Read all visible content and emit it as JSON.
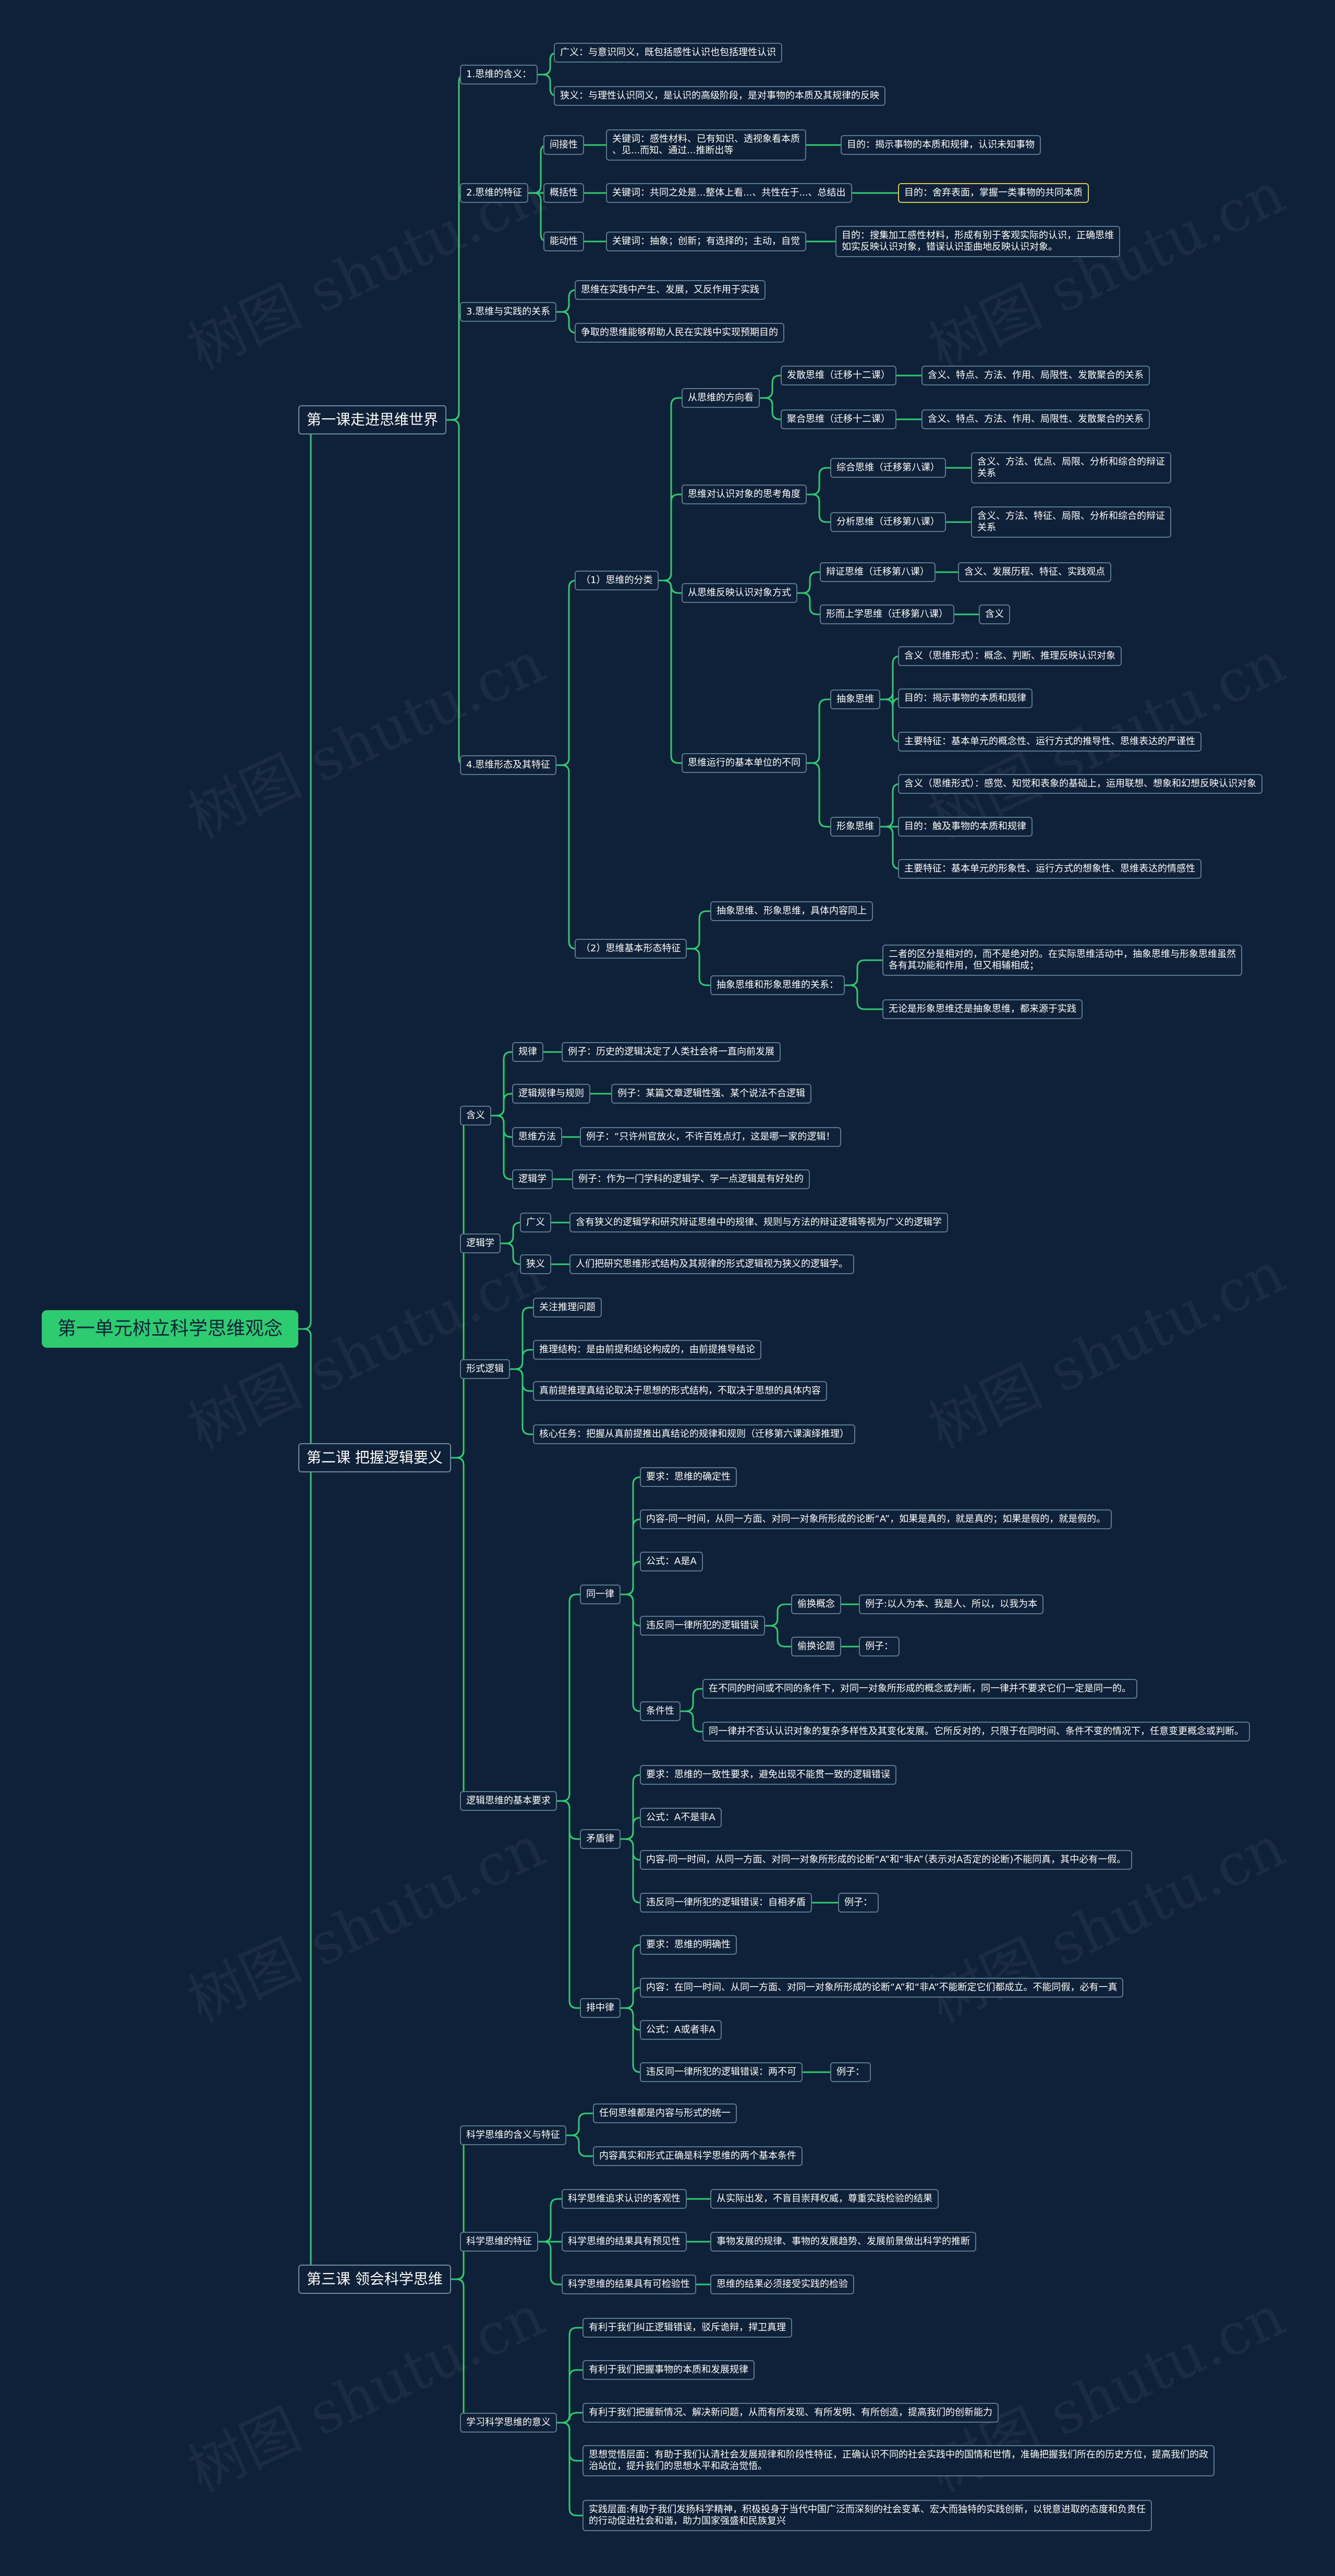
{
  "colors": {
    "background": "#0f2138",
    "root": "#2ecc71",
    "link": "#2ecc71",
    "border": "#5a7a8a",
    "highlight": "#d9c84a"
  },
  "watermark": "树图 shutu.cn",
  "tree": {
    "id": "root",
    "label": "第一单元树立科学思维观念",
    "children": [
      {
        "id": "c1",
        "label": "第一课走进思维世界",
        "children": [
          {
            "id": "c1a",
            "label": "1.思维的含义：",
            "children": [
              {
                "id": "c1a1",
                "label": "广义：与意识同义，既包括感性认识也包括理性认识"
              },
              {
                "id": "c1a2",
                "label": "狭义：与理性认识同义，是认识的高级阶段，是对事物的本质及其规律的反映"
              }
            ]
          },
          {
            "id": "c1b",
            "label": "2.思维的特征",
            "children": [
              {
                "id": "c1b1",
                "label": "间接性",
                "children": [
                  {
                    "id": "c1b1a",
                    "label": "关键词：感性材料、已有知识、透视象看本质\n、见...而知、通过...推断出等",
                    "children": [
                      {
                        "id": "c1b1a1",
                        "label": "目的：揭示事物的本质和规律，认识未知事物"
                      }
                    ]
                  }
                ]
              },
              {
                "id": "c1b2",
                "label": "概括性",
                "children": [
                  {
                    "id": "c1b2a",
                    "label": "关键词：共同之处是...整体上看...、共性在于...、总结出",
                    "children": [
                      {
                        "id": "c1b2a1",
                        "label": "目的：舍弃表面，掌握一类事物的共同本质",
                        "hl": true
                      }
                    ]
                  }
                ]
              },
              {
                "id": "c1b3",
                "label": "能动性",
                "children": [
                  {
                    "id": "c1b3a",
                    "label": "关键词：抽象；创新；有选择的；主动，自觉",
                    "children": [
                      {
                        "id": "c1b3a1",
                        "label": "目的：搜集加工感性材料，形成有别于客观实际的认识，正确思维\n如实反映认识对象，错误认识歪曲地反映认识对象。"
                      }
                    ]
                  }
                ]
              }
            ]
          },
          {
            "id": "c1c",
            "label": "3.思维与实践的关系",
            "children": [
              {
                "id": "c1c1",
                "label": "思维在实践中产生、发展，又反作用于实践"
              },
              {
                "id": "c1c2",
                "label": "争取的思维能够帮助人民在实践中实现预期目的"
              }
            ]
          },
          {
            "id": "c1d",
            "label": "4.思维形态及其特征",
            "children": [
              {
                "id": "c1d1",
                "label": "（1）思维的分类",
                "children": [
                  {
                    "id": "c1d1a",
                    "label": "从思维的方向看",
                    "children": [
                      {
                        "id": "c1d1a1",
                        "label": "发散思维（迁移十二课）",
                        "children": [
                          {
                            "id": "c1d1a1x",
                            "label": "含义、特点、方法、作用、局限性、发散聚合的关系"
                          }
                        ]
                      },
                      {
                        "id": "c1d1a2",
                        "label": "聚合思维（迁移十二课）",
                        "children": [
                          {
                            "id": "c1d1a2x",
                            "label": "含义、特点、方法、作用、局限性、发散聚合的关系"
                          }
                        ]
                      }
                    ]
                  },
                  {
                    "id": "c1d1b",
                    "label": "思维对认识对象的思考角度",
                    "children": [
                      {
                        "id": "c1d1b1",
                        "label": "综合思维（迁移第八课）",
                        "children": [
                          {
                            "id": "c1d1b1x",
                            "label": "含义、方法、优点、局限、分析和综合的辩证\n关系"
                          }
                        ]
                      },
                      {
                        "id": "c1d1b2",
                        "label": "分析思维（迁移第八课）",
                        "children": [
                          {
                            "id": "c1d1b2x",
                            "label": "含义、方法、特征、局限、分析和综合的辩证\n关系"
                          }
                        ]
                      }
                    ]
                  },
                  {
                    "id": "c1d1c",
                    "label": "从思维反映认识对象方式",
                    "children": [
                      {
                        "id": "c1d1c1",
                        "label": "辩证思维（迁移第八课）",
                        "children": [
                          {
                            "id": "c1d1c1x",
                            "label": "含义、发展历程、特征、实践观点"
                          }
                        ]
                      },
                      {
                        "id": "c1d1c2",
                        "label": "形而上学思维（迁移第八课）",
                        "children": [
                          {
                            "id": "c1d1c2x",
                            "label": "含义"
                          }
                        ]
                      }
                    ]
                  },
                  {
                    "id": "c1d1d",
                    "label": "思维运行的基本单位的不同",
                    "children": [
                      {
                        "id": "c1d1d1",
                        "label": "抽象思维",
                        "children": [
                          {
                            "id": "c1d1d1a",
                            "label": "含义（思维形式）：概念、判断、推理反映认识对象"
                          },
                          {
                            "id": "c1d1d1b",
                            "label": "目的：揭示事物的本质和规律"
                          },
                          {
                            "id": "c1d1d1c",
                            "label": "主要特征：基本单元的概念性、运行方式的推导性、思维表达的严谨性"
                          }
                        ]
                      },
                      {
                        "id": "c1d1d2",
                        "label": "形象思维",
                        "children": [
                          {
                            "id": "c1d1d2a",
                            "label": "含义（思维形式）：感觉、知觉和表象的基础上，运用联想、想象和幻想反映认识对象"
                          },
                          {
                            "id": "c1d1d2b",
                            "label": "目的：触及事物的本质和规律"
                          },
                          {
                            "id": "c1d1d2c",
                            "label": "主要特征：基本单元的形象性、运行方式的想象性、思维表达的情感性"
                          }
                        ]
                      }
                    ]
                  }
                ]
              },
              {
                "id": "c1d2",
                "label": "（2）思维基本形态特征",
                "children": [
                  {
                    "id": "c1d2a",
                    "label": "抽象思维、形象思维，具体内容同上"
                  },
                  {
                    "id": "c1d2b",
                    "label": "抽象思维和形象思维的关系：",
                    "children": [
                      {
                        "id": "c1d2b1",
                        "label": "二者的区分是相对的，而不是绝对的。在实际思维活动中，抽象思维与形象思维虽然\n各有其功能和作用，但又相辅相成；"
                      },
                      {
                        "id": "c1d2b2",
                        "label": "无论是形象思维还是抽象思维，都来源于实践"
                      }
                    ]
                  }
                ]
              }
            ]
          }
        ]
      },
      {
        "id": "c2",
        "label": "第二课 把握逻辑要义",
        "children": [
          {
            "id": "c2a",
            "label": "含义",
            "children": [
              {
                "id": "c2a1",
                "label": "规律",
                "children": [
                  {
                    "id": "c2a1x",
                    "label": "例子：历史的逻辑决定了人类社会将一直向前发展"
                  }
                ]
              },
              {
                "id": "c2a2",
                "label": "逻辑规律与规则",
                "children": [
                  {
                    "id": "c2a2x",
                    "label": "例子：某篇文章逻辑性强、某个说法不合逻辑"
                  }
                ]
              },
              {
                "id": "c2a3",
                "label": "思维方法",
                "children": [
                  {
                    "id": "c2a3x",
                    "label": "例子：“只许州官放火，不许百姓点灯，这是哪一家的逻辑！"
                  }
                ]
              },
              {
                "id": "c2a4",
                "label": "逻辑学",
                "children": [
                  {
                    "id": "c2a4x",
                    "label": "例子：作为一门学科的逻辑学、学一点逻辑是有好处的"
                  }
                ]
              }
            ]
          },
          {
            "id": "c2b",
            "label": "逻辑学",
            "children": [
              {
                "id": "c2b1",
                "label": "广义",
                "children": [
                  {
                    "id": "c2b1x",
                    "label": "含有狭义的逻辑学和研究辩证思维中的规律、规则与方法的辩证逻辑等视为广义的逻辑学"
                  }
                ]
              },
              {
                "id": "c2b2",
                "label": "狭义",
                "children": [
                  {
                    "id": "c2b2x",
                    "label": "人们把研究思维形式结构及其规律的形式逻辑视为狭义的逻辑学。"
                  }
                ]
              }
            ]
          },
          {
            "id": "c2c",
            "label": "形式逻辑",
            "children": [
              {
                "id": "c2c1",
                "label": "关注推理问题"
              },
              {
                "id": "c2c2",
                "label": "推理结构：是由前提和结论构成的，由前提推导结论"
              },
              {
                "id": "c2c3",
                "label": "真前提推理真结论取决于思想的形式结构，不取决于思想的具体内容"
              },
              {
                "id": "c2c4",
                "label": "核心任务：把握从真前提推出真结论的规律和规则（迁移第六课演绎推理）"
              }
            ]
          },
          {
            "id": "c2d",
            "label": "逻辑思维的基本要求",
            "children": [
              {
                "id": "c2d1",
                "label": "同一律",
                "children": [
                  {
                    "id": "c2d1a",
                    "label": "要求：思维的确定性"
                  },
                  {
                    "id": "c2d1b",
                    "label": "内容-同一时间，从同一方面、对同一对象所形成的论断“A”，如果是真的，就是真的；如果是假的，就是假的。"
                  },
                  {
                    "id": "c2d1c",
                    "label": "公式：A是A"
                  },
                  {
                    "id": "c2d1d",
                    "label": "违反同一律所犯的逻辑错误",
                    "children": [
                      {
                        "id": "c2d1d1",
                        "label": "偷换概念",
                        "children": [
                          {
                            "id": "c2d1d1x",
                            "label": "例子:以人为本、我是人、所以，以我为本"
                          }
                        ]
                      },
                      {
                        "id": "c2d1d2",
                        "label": "偷换论题",
                        "children": [
                          {
                            "id": "c2d1d2x",
                            "label": "例子："
                          }
                        ]
                      }
                    ]
                  },
                  {
                    "id": "c2d1e",
                    "label": "条件性",
                    "children": [
                      {
                        "id": "c2d1e1",
                        "label": "在不同的时间或不同的条件下，对同一对象所形成的概念或判断，同一律并不要求它们一定是同一的。"
                      },
                      {
                        "id": "c2d1e2",
                        "label": "同一律并不否认认识对象的复杂多样性及其变化发展。它所反对的，只限于在同时间、条件不变的情况下，任意变更概念或判断。"
                      }
                    ]
                  }
                ]
              },
              {
                "id": "c2d2",
                "label": "矛盾律",
                "children": [
                  {
                    "id": "c2d2a",
                    "label": "要求：思维的一致性要求，避免出现不能贯一致的逻辑错误"
                  },
                  {
                    "id": "c2d2b",
                    "label": "公式：A不是非A"
                  },
                  {
                    "id": "c2d2c",
                    "label": "内容-同一时间，从同一方面、对同一对象所形成的论断“A”和“非A”（表示对A否定的论断)不能同真，其中必有一假。"
                  },
                  {
                    "id": "c2d2d",
                    "label": "违反同一律所犯的逻辑错误：自相矛盾",
                    "children": [
                      {
                        "id": "c2d2dx",
                        "label": "例子："
                      }
                    ]
                  }
                ]
              },
              {
                "id": "c2d3",
                "label": "排中律",
                "children": [
                  {
                    "id": "c2d3a",
                    "label": "要求：思维的明确性"
                  },
                  {
                    "id": "c2d3b",
                    "label": "内容：在同一时间、从同一方面、对同一对象所形成的论断“A”和“非A”不能断定它们都成立。不能同假，必有一真"
                  },
                  {
                    "id": "c2d3c",
                    "label": "公式：A或者非A"
                  },
                  {
                    "id": "c2d3d",
                    "label": "违反同一律所犯的逻辑错误：两不可",
                    "children": [
                      {
                        "id": "c2d3dx",
                        "label": "例子："
                      }
                    ]
                  }
                ]
              }
            ]
          }
        ]
      },
      {
        "id": "c3",
        "label": "第三课 领会科学思维",
        "children": [
          {
            "id": "c3a",
            "label": "科学思维的含义与特征",
            "children": [
              {
                "id": "c3a1",
                "label": "任何思维都是内容与形式的统一"
              },
              {
                "id": "c3a2",
                "label": "内容真实和形式正确是科学思维的两个基本条件"
              }
            ]
          },
          {
            "id": "c3b",
            "label": "科学思维的特征",
            "children": [
              {
                "id": "c3b1",
                "label": "科学思维追求认识的客观性",
                "children": [
                  {
                    "id": "c3b1x",
                    "label": "从实际出发，不盲目崇拜权威，尊重实践检验的结果"
                  }
                ]
              },
              {
                "id": "c3b2",
                "label": "科学思维的结果具有预见性",
                "children": [
                  {
                    "id": "c3b2x",
                    "label": "事物发展的规律、事物的发展趋势、发展前景做出科学的推断"
                  }
                ]
              },
              {
                "id": "c3b3",
                "label": "科学思维的结果具有可检验性",
                "children": [
                  {
                    "id": "c3b3x",
                    "label": "思维的结果必须接受实践的检验"
                  }
                ]
              }
            ]
          },
          {
            "id": "c3c",
            "label": "学习科学思维的意义",
            "children": [
              {
                "id": "c3c1",
                "label": "有利于我们纠正逻辑错误，驳斥诡辩，捍卫真理"
              },
              {
                "id": "c3c2",
                "label": "有利于我们把握事物的本质和发展规律"
              },
              {
                "id": "c3c3",
                "label": "有利于我们把握新情况、解决新问题，从而有所发现、有所发明、有所创造，提高我们的创新能力"
              },
              {
                "id": "c3c4",
                "label": "思想觉悟层面：有助于我们认清社会发展规律和阶段性特征，正确认识不同的社会实践中的国情和世情，准确把握我们所在的历史方位，提高我们的政\n治站位，提升我们的思想水平和政治觉悟。"
              },
              {
                "id": "c3c5",
                "label": "实践层面:有助于我们发扬科学精神，积极投身于当代中国广泛而深刻的社会变革、宏大而独特的实践创新，以锐意进取的态度和负责任\n的行动促进社会和谐，助力国家强盛和民族复兴"
              }
            ]
          }
        ]
      }
    ]
  }
}
